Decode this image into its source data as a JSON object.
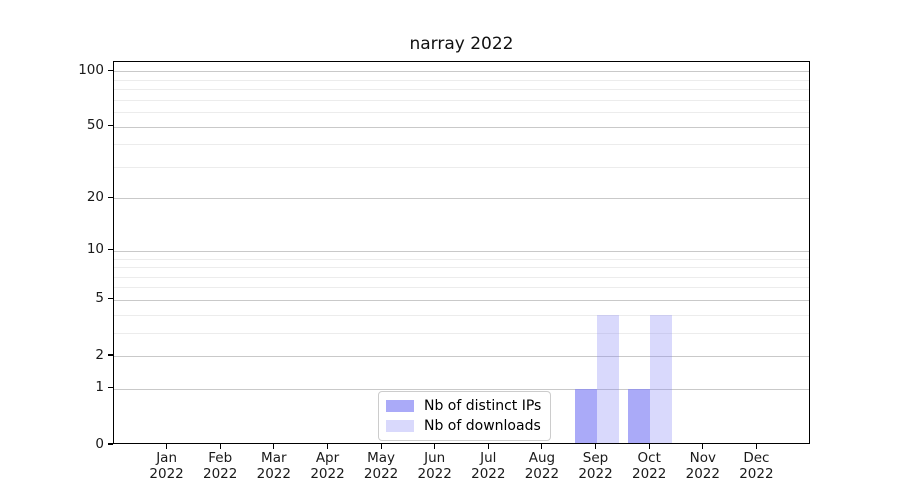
{
  "chart_data": {
    "type": "bar",
    "title": "narray 2022",
    "x_axis": {
      "categories": [
        "Jan",
        "Feb",
        "Mar",
        "Apr",
        "May",
        "Jun",
        "Jul",
        "Aug",
        "Sep",
        "Oct",
        "Nov",
        "Dec"
      ],
      "year": "2022"
    },
    "y_axis": {
      "scale": "log1p",
      "ticks": [
        0,
        1,
        2,
        5,
        10,
        20,
        50,
        100
      ],
      "ylim": [
        0,
        112
      ],
      "grid": true
    },
    "series": [
      {
        "name": "Nb of distinct IPs",
        "color": "rgba(130,130,245,0.68)",
        "values": [
          0,
          0,
          0,
          0,
          0,
          0,
          0,
          0,
          1,
          1,
          0,
          0
        ]
      },
      {
        "name": "Nb of downloads",
        "color": "rgba(130,130,245,0.30)",
        "values": [
          0,
          0,
          0,
          0,
          0,
          0,
          0,
          0,
          4,
          4,
          0,
          0
        ]
      }
    ],
    "legend": {
      "position": "bottom-center-inside"
    }
  },
  "colors": {
    "major_grid": "#c9c9c9",
    "minor_grid": "#ececec",
    "spine": "#000000",
    "background": "#ffffff"
  }
}
